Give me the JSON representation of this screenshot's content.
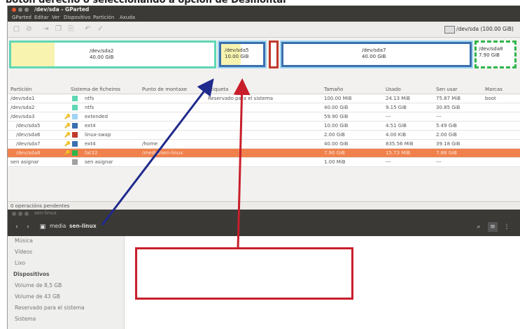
{
  "caption": "botón derecho o seleccionando a opción de Desmontar",
  "gparted": {
    "window_title": "/dev/sda - GParted",
    "menu": [
      "GParted",
      "Editar",
      "Ver",
      "Dispositivo",
      "Partición",
      "Axuda"
    ],
    "device": "/dev/sda (100.00 GiB)",
    "map": [
      {
        "name": "/dev/sda2",
        "size": "40.00 GiB",
        "color": "#5fd7b4"
      },
      {
        "name": "/dev/sda5",
        "size": "10.00 GiB",
        "color": "#3b6fae"
      },
      {
        "name": "/dev/sda7",
        "size": "40.00 GiB",
        "color": "#3b6fae"
      },
      {
        "name": "/dev/sda8",
        "size": "7.90 GiB",
        "color": "#2fb54a"
      }
    ],
    "columns": [
      "Partición",
      "Sistema de ficheiros",
      "Punto de montaxe",
      "Etiqueta",
      "Tamaño",
      "Usado",
      "Sen usar",
      "Marcas"
    ],
    "rows": [
      {
        "partition": "/dev/sda1",
        "fs": "ntfs",
        "mount": "",
        "label": "Reservado para el sistema",
        "size": "100.00 MiB",
        "used": "24.13 MiB",
        "unused": "75.87 MiB",
        "flags": "boot",
        "fs_color": "#5fd7b4"
      },
      {
        "partition": "/dev/sda2",
        "fs": "ntfs",
        "mount": "",
        "label": "",
        "size": "40.00 GiB",
        "used": "9.15 GiB",
        "unused": "30.85 GiB",
        "flags": "",
        "fs_color": "#5fd7b4"
      },
      {
        "partition": "/dev/sda3",
        "fs": "extended",
        "mount": "",
        "label": "",
        "size": "59.90 GiB",
        "used": "---",
        "unused": "---",
        "flags": "",
        "fs_color": "#9fd5f2"
      },
      {
        "partition": "/dev/sda5",
        "fs": "ext4",
        "mount": "",
        "label": "",
        "size": "10.00 GiB",
        "used": "4.51 GiB",
        "unused": "5.49 GiB",
        "flags": "",
        "fs_color": "#3b6fae"
      },
      {
        "partition": "/dev/sda6",
        "fs": "linux-swap",
        "mount": "",
        "label": "",
        "size": "2.00 GiB",
        "used": "4.00 KiB",
        "unused": "2.00 GiB",
        "flags": "",
        "fs_color": "#c0392b"
      },
      {
        "partition": "/dev/sda7",
        "fs": "ext4",
        "mount": "/home",
        "label": "",
        "size": "40.00 GiB",
        "used": "835.56 MiB",
        "unused": "39.18 GiB",
        "flags": "",
        "fs_color": "#3b6fae"
      },
      {
        "partition": "/dev/sda8",
        "fs": "fat32",
        "mount": "/media/sen-linux",
        "label": "",
        "size": "7.90 GiB",
        "used": "15.73 MiB",
        "unused": "7.88 GiB",
        "flags": "",
        "fs_color": "#2fb54a"
      },
      {
        "partition": "sen asignar",
        "fs": "sen asignar",
        "mount": "",
        "label": "",
        "size": "1.00 MiB",
        "used": "---",
        "unused": "---",
        "flags": "",
        "fs_color": "#a0a0a0"
      }
    ],
    "status": "0 operacións pendentes"
  },
  "files": {
    "window_title": "sen-linux",
    "crumbs": [
      "media",
      "sen-linux"
    ],
    "sidebar": [
      {
        "label": "Música",
        "type": "item"
      },
      {
        "label": "Vídeos",
        "type": "item"
      },
      {
        "label": "Lixo",
        "type": "item"
      },
      {
        "label": "Dispositivos",
        "type": "header"
      },
      {
        "label": "Volume de 8,5 GB",
        "type": "item"
      },
      {
        "label": "Volume de 43 GB",
        "type": "item"
      },
      {
        "label": "Reservado para el sistema",
        "type": "item"
      },
      {
        "label": "Sistema",
        "type": "item"
      }
    ]
  }
}
